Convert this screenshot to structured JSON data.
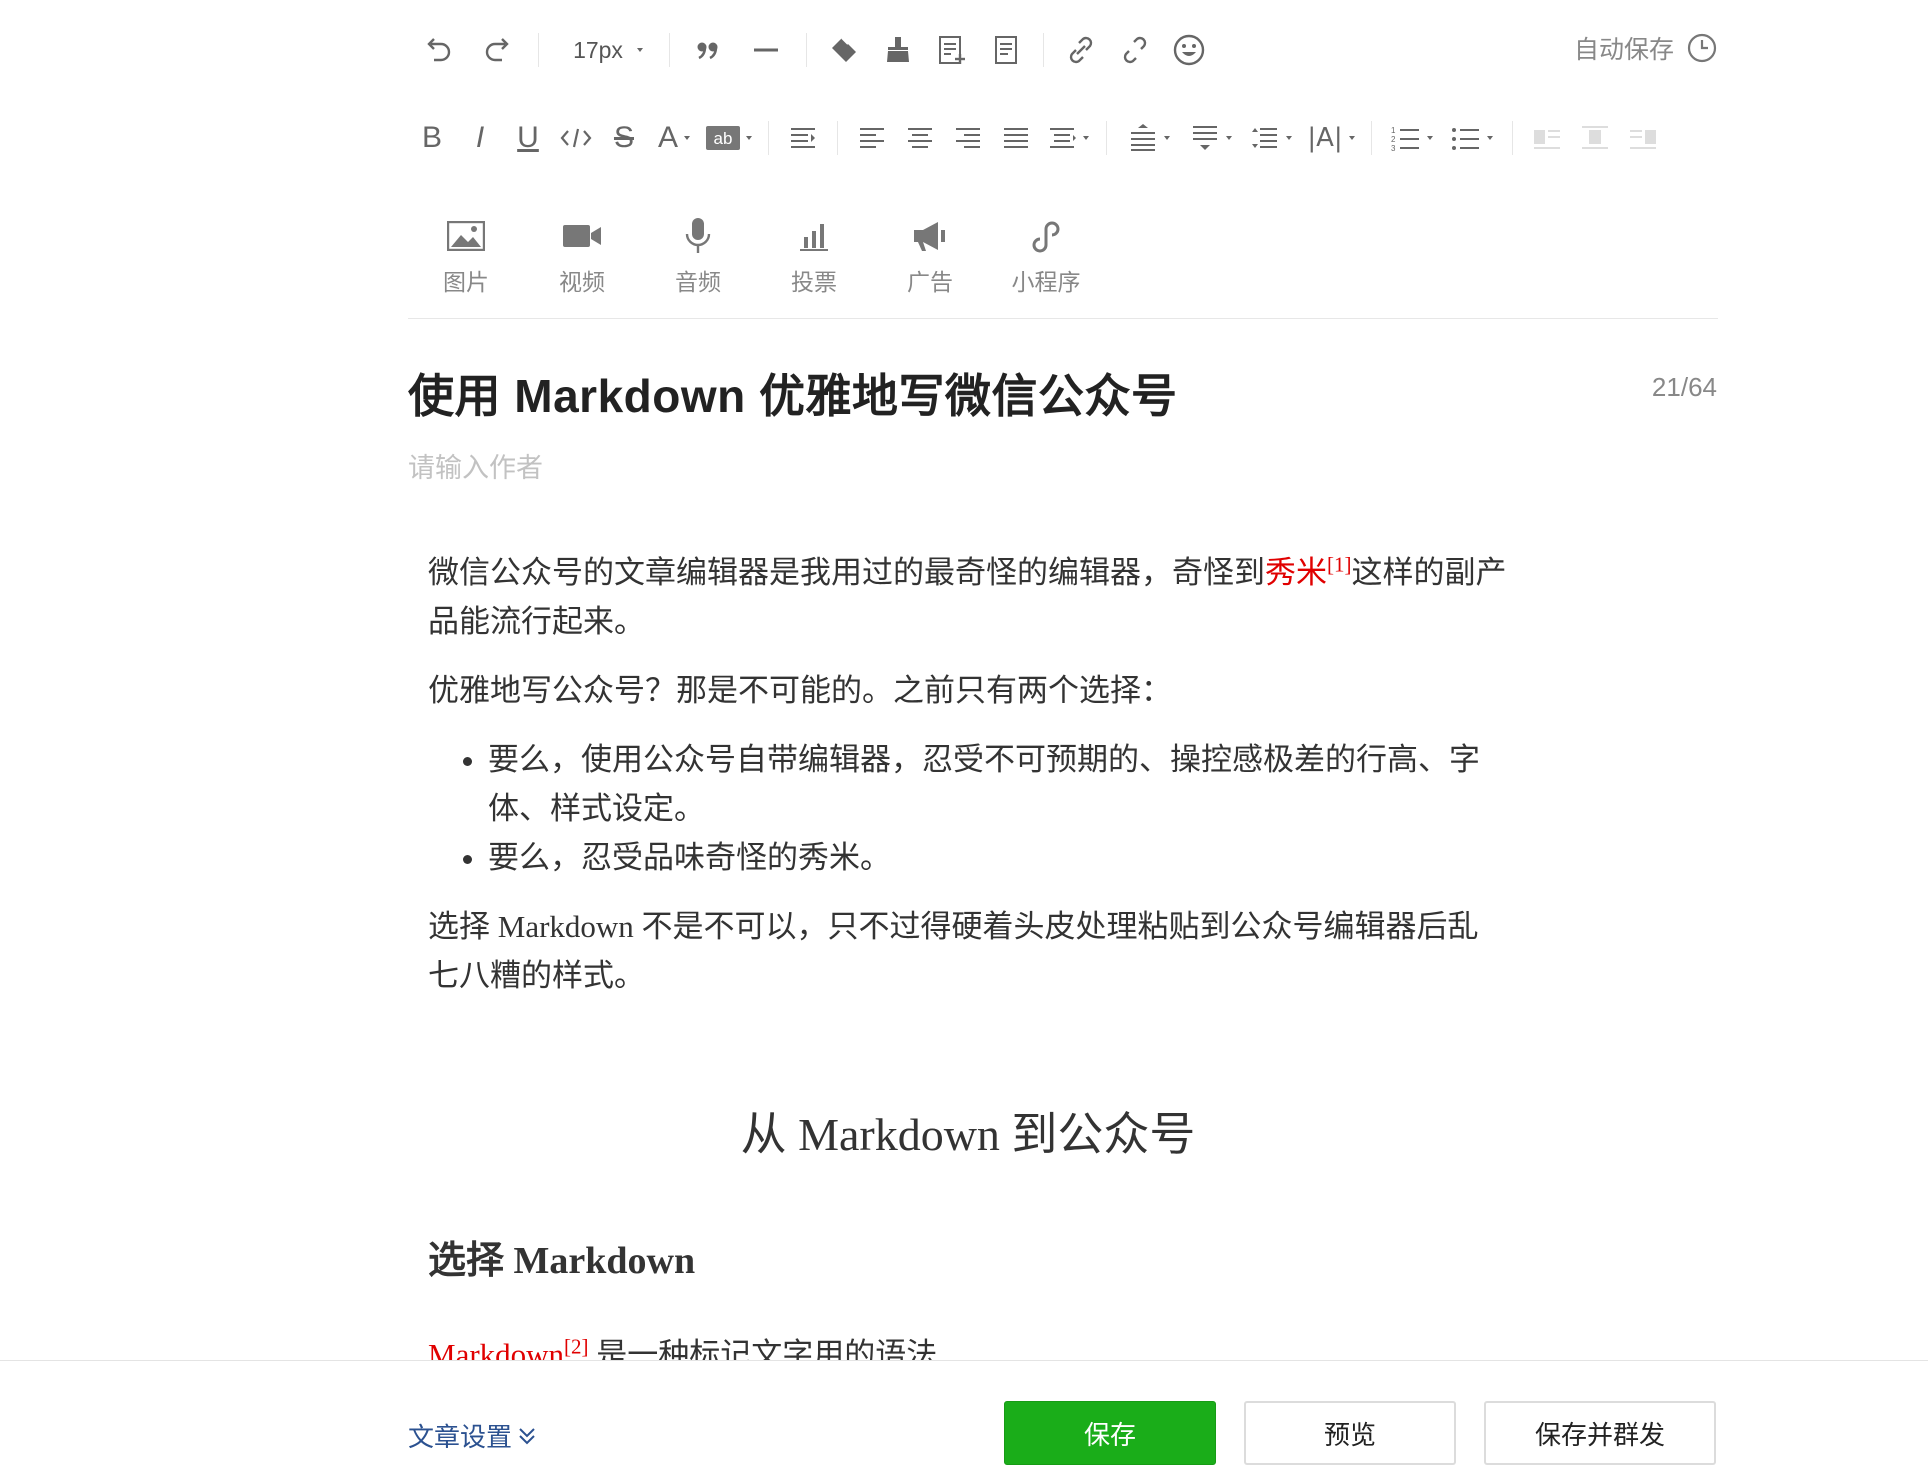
{
  "toolbar": {
    "font_size": "17px",
    "autosave_label": "自动保存"
  },
  "insert": [
    {
      "label": "图片",
      "icon": "image-icon"
    },
    {
      "label": "视频",
      "icon": "video-icon"
    },
    {
      "label": "音频",
      "icon": "microphone-icon"
    },
    {
      "label": "投票",
      "icon": "poll-icon"
    },
    {
      "label": "广告",
      "icon": "megaphone-icon"
    },
    {
      "label": "小程序",
      "icon": "mini-program-icon"
    }
  ],
  "editor": {
    "title": "使用 Markdown 优雅地写微信公众号",
    "title_counter": "21/64",
    "author_placeholder": "请输入作者"
  },
  "article": {
    "p1_before": "微信公众号的文章编辑器是我用过的最奇怪的编辑器，奇怪到",
    "p1_link": "秀米",
    "p1_ref": "[1]",
    "p1_after": "这样的副产品能流行起来。",
    "p2": "优雅地写公众号？那是不可能的。之前只有两个选择：",
    "bullets": [
      "要么，使用公众号自带编辑器，忍受不可预期的、操控感极差的行高、字体、样式设定。",
      "要么，忍受品味奇怪的秀米。"
    ],
    "p3": "选择 Markdown 不是不可以，只不过得硬着头皮处理粘贴到公众号编辑器后乱七八糟的样式。",
    "h2": "从 Markdown 到公众号",
    "h3": "选择 Markdown",
    "p4_link": "Markdown",
    "p4_ref": "[2]",
    "p4_after": " 是一种标记文字用的语法"
  },
  "bottom": {
    "settings_label": "文章设置",
    "save_label": "保存",
    "preview_label": "预览",
    "save_mass_label": "保存并群发"
  },
  "colors": {
    "primary_green": "#1aad19",
    "link_red": "#e00000",
    "settings_blue": "#2b5190"
  }
}
